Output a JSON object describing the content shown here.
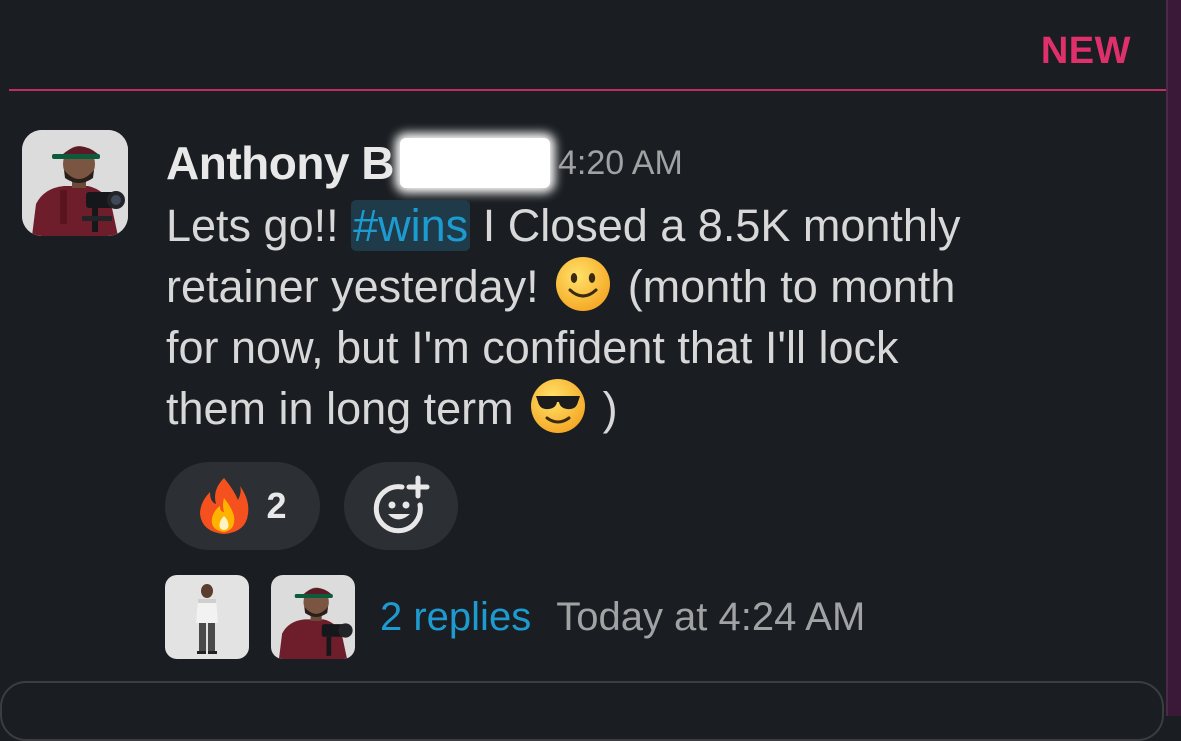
{
  "divider": {
    "label": "NEW"
  },
  "message": {
    "author": "Anthony B",
    "timestamp": "4:20 AM",
    "lines": {
      "l1_a": "Lets go!! ",
      "l1_hashtag": "#wins",
      "l1_b": " I Closed a 8.5K monthly",
      "l2_a": "retainer yesterday! ",
      "l2_b": "  (month to month",
      "l3": "for now, but I'm confident that I'll lock",
      "l4_a": "them in long term ",
      "l4_b": " )"
    },
    "emojis": {
      "smile": "slightly-smiling-face-icon",
      "cool": "smiling-face-with-sunglasses-icon"
    }
  },
  "reactions": [
    {
      "icon": "fire-icon",
      "count": "2"
    },
    {
      "icon": "add-reaction-icon"
    }
  ],
  "thread": {
    "replies": "2 replies",
    "last_reply": "Today at 4:24 AM"
  },
  "colors": {
    "background": "#1a1d21",
    "new": "#e0306b",
    "link": "#1d9bd1",
    "pill": "#2c2f33"
  }
}
